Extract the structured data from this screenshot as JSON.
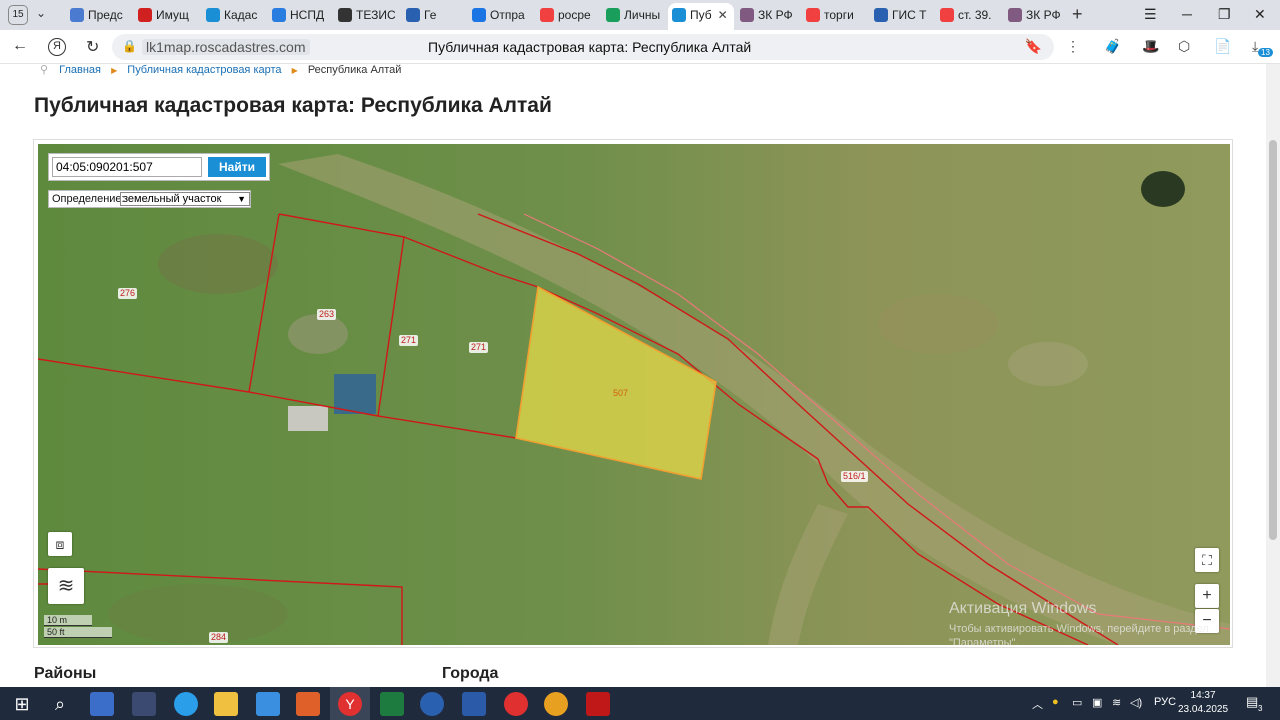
{
  "browser": {
    "tab_count": "15",
    "tabs": [
      {
        "label": "Предс",
        "color": "#4a7bd0"
      },
      {
        "label": "Имущ",
        "color": "#d02020"
      },
      {
        "label": "Кадас",
        "color": "#1a8fd6"
      },
      {
        "label": "НСПД",
        "color": "#2a7de0"
      },
      {
        "label": "ТЕЗИС",
        "color": "#333333"
      },
      {
        "label": "Ге",
        "color": "#2a60b0"
      },
      {
        "label": "Отпра",
        "color": "#1b74e4"
      },
      {
        "label": "росре",
        "color": "#f04040"
      },
      {
        "label": "Личны",
        "color": "#1a9e5c"
      },
      {
        "label": "Пуб",
        "color": "#1a8fd6"
      },
      {
        "label": "ЗК РФ",
        "color": "#805a80"
      },
      {
        "label": "торги",
        "color": "#f04040"
      },
      {
        "label": "ГИС Т",
        "color": "#2a60b0"
      },
      {
        "label": "ст. 39.",
        "color": "#f04040"
      },
      {
        "label": "ЗК РФ",
        "color": "#805a80"
      }
    ],
    "active_tab_index": 9,
    "address": {
      "domain": "lk1map.roscadastres.com",
      "page_title": "Публичная кадастровая карта: Республика Алтай"
    },
    "extension_badge": "13"
  },
  "breadcrumb": {
    "home": "Главная",
    "map": "Публичная кадастровая карта",
    "current": "Республика Алтай"
  },
  "page_title": "Публичная кадастровая карта: Республика Алтай",
  "map": {
    "search_value": "04:05:090201:507",
    "search_button": "Найти",
    "definition_label": "Определение:",
    "definition_value": "земельный участок",
    "scale_metric": "10 m",
    "scale_imperial": "50 ft",
    "zoom_in": "+",
    "zoom_out": "−",
    "parcel_labels": {
      "p276": "276",
      "p263": "263",
      "p271a": "271",
      "p271b": "271",
      "p507": "507",
      "p516": "516/1",
      "p284": "284"
    },
    "watermark_title": "Активация Windows",
    "watermark_sub": "Чтобы активировать Windows, перейдите в раздел \"Параметры\"."
  },
  "sections": {
    "left": "Районы",
    "right": "Города"
  },
  "taskbar": {
    "lang": "РУС",
    "time": "14:37",
    "date": "23.04.2025",
    "notifications": "3"
  },
  "colors": {
    "accent": "#1b8fd6",
    "parcel_border": "#d01818",
    "selected_fill": "#e6d94a",
    "selected_border": "#f0a030"
  }
}
